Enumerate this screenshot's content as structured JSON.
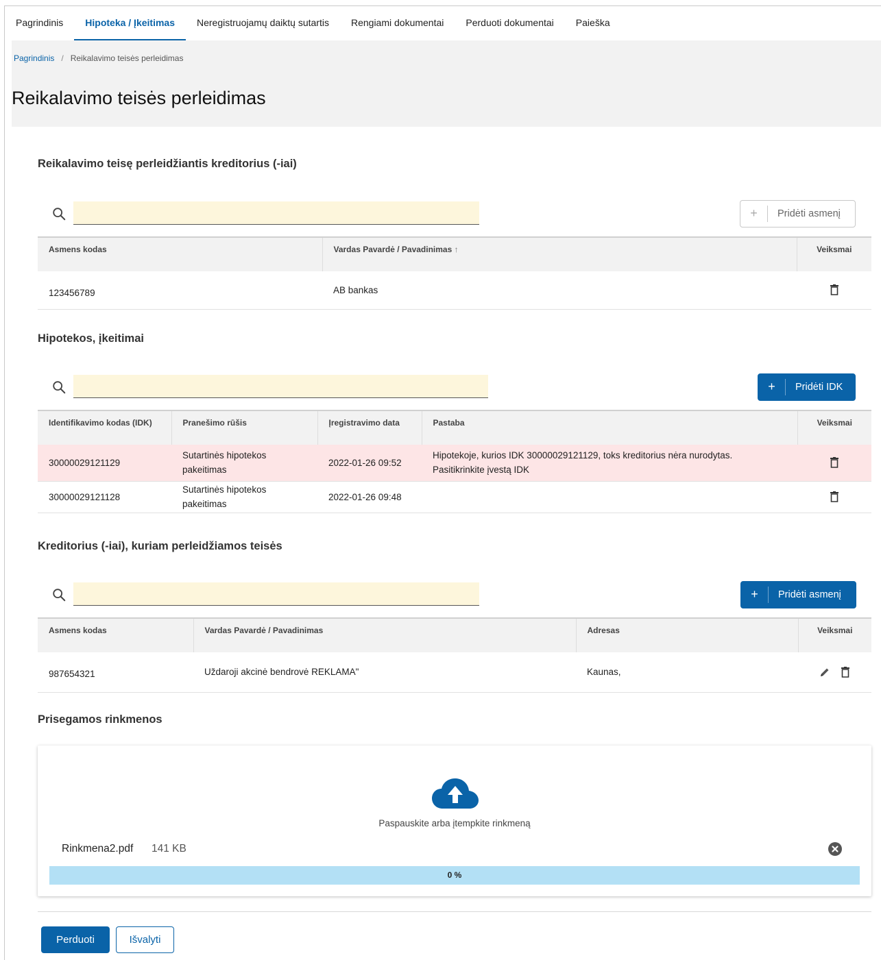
{
  "nav": {
    "tabs": [
      {
        "label": "Pagrindinis"
      },
      {
        "label": "Hipoteka / Įkeitimas"
      },
      {
        "label": "Neregistruojamų daiktų sutartis"
      },
      {
        "label": "Rengiami dokumentai"
      },
      {
        "label": "Perduoti dokumentai"
      },
      {
        "label": "Paieška"
      }
    ],
    "active_index": 1
  },
  "breadcrumb": {
    "home": "Pagrindinis",
    "separator": "/",
    "current": "Reikalavimo teisės perleidimas"
  },
  "page_title": "Reikalavimo teisės perleidimas",
  "section1": {
    "title": "Reikalavimo teisę perleidžiantis kreditorius (-iai)",
    "search_value": "",
    "add_button": {
      "plus": "+",
      "label": "Pridėti asmenį",
      "enabled": false
    },
    "columns": [
      "Asmens kodas",
      "Vardas Pavardė / Pavadinimas",
      "Veiksmai"
    ],
    "sort_indicator": "↑",
    "rows": [
      {
        "code": "123456789",
        "name": "AB   bankas"
      }
    ]
  },
  "section2": {
    "title": "Hipotekos, įkeitimai",
    "search_value": "",
    "add_button": {
      "plus": "+",
      "label": "Pridėti IDK",
      "enabled": true
    },
    "columns": [
      "Identifikavimo kodas (IDK)",
      "Pranešimo rūšis",
      "Įregistravimo data",
      "Pastaba",
      "Veiksmai"
    ],
    "rows": [
      {
        "idk": "30000029121129",
        "type": "Sutartinės hipotekos pakeitimas",
        "date": "2022-01-26 09:52",
        "note": "Hipotekoje, kurios IDK 30000029121129, toks kreditorius nėra nurodytas. Pasitikrinkite įvestą IDK",
        "error": true
      },
      {
        "idk": "30000029121128",
        "type": "Sutartinės hipotekos pakeitimas",
        "date": "2022-01-26 09:48",
        "note": "",
        "error": false
      }
    ]
  },
  "section3": {
    "title": "Kreditorius (-iai), kuriam perleidžiamos teisės",
    "search_value": "",
    "add_button": {
      "plus": "+",
      "label": "Pridėti asmenį",
      "enabled": true
    },
    "columns": [
      "Asmens kodas",
      "Vardas Pavardė / Pavadinimas",
      "Adresas",
      "Veiksmai"
    ],
    "rows": [
      {
        "code": "987654321",
        "name": "Uždaroji akcinė bendrovė REKLAMA\"",
        "address": "Kaunas,"
      }
    ]
  },
  "attachments": {
    "title": "Prisegamos rinkmenos",
    "hint": "Paspauskite arba įtempkite rinkmeną",
    "file": {
      "name": "Rinkmena2.pdf",
      "size": "141 KB",
      "progress_label": "0 %",
      "progress": 0
    }
  },
  "actions": {
    "submit": "Perduoti",
    "clear": "Išvalyti"
  },
  "colors": {
    "primary": "#0a63a8",
    "error_row": "#fde5e6",
    "search_bg": "#fdf6dc",
    "progress_bg": "#b3e0f5"
  }
}
